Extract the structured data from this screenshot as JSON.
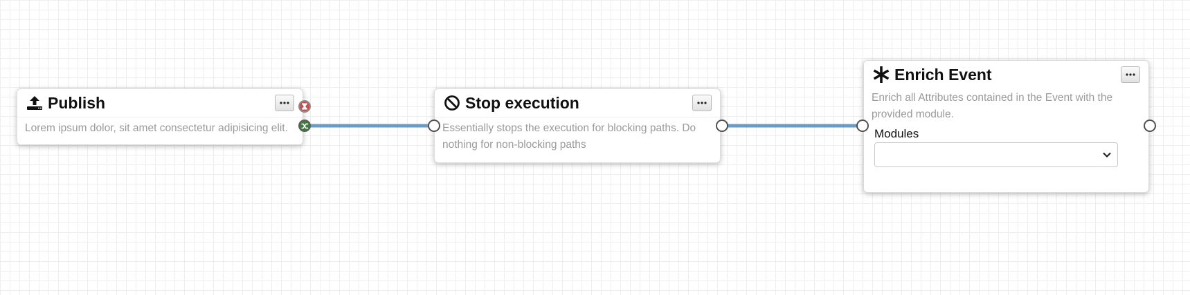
{
  "colors": {
    "connection": "#6b9bc3",
    "error_port": "#c94f4f",
    "success_port": "#3f7a3f",
    "description_text": "#9a9a9a"
  },
  "nodes": [
    {
      "title": "Publish",
      "icon": "upload-icon",
      "description": "Lorem ipsum dolor, sit amet consectetur adipisicing elit."
    },
    {
      "title": "Stop execution",
      "icon": "ban-icon",
      "description": "Essentially stops the execution for blocking paths. Do nothing for non-blocking paths"
    },
    {
      "title": "Enrich Event",
      "icon": "asterisk-icon",
      "description": "Enrich all Attributes contained in the Event with the provided module.",
      "field": {
        "label": "Modules",
        "value": ""
      }
    }
  ],
  "ports": {
    "error_icon": "hourglass-icon",
    "success_icon": "random-icon"
  }
}
